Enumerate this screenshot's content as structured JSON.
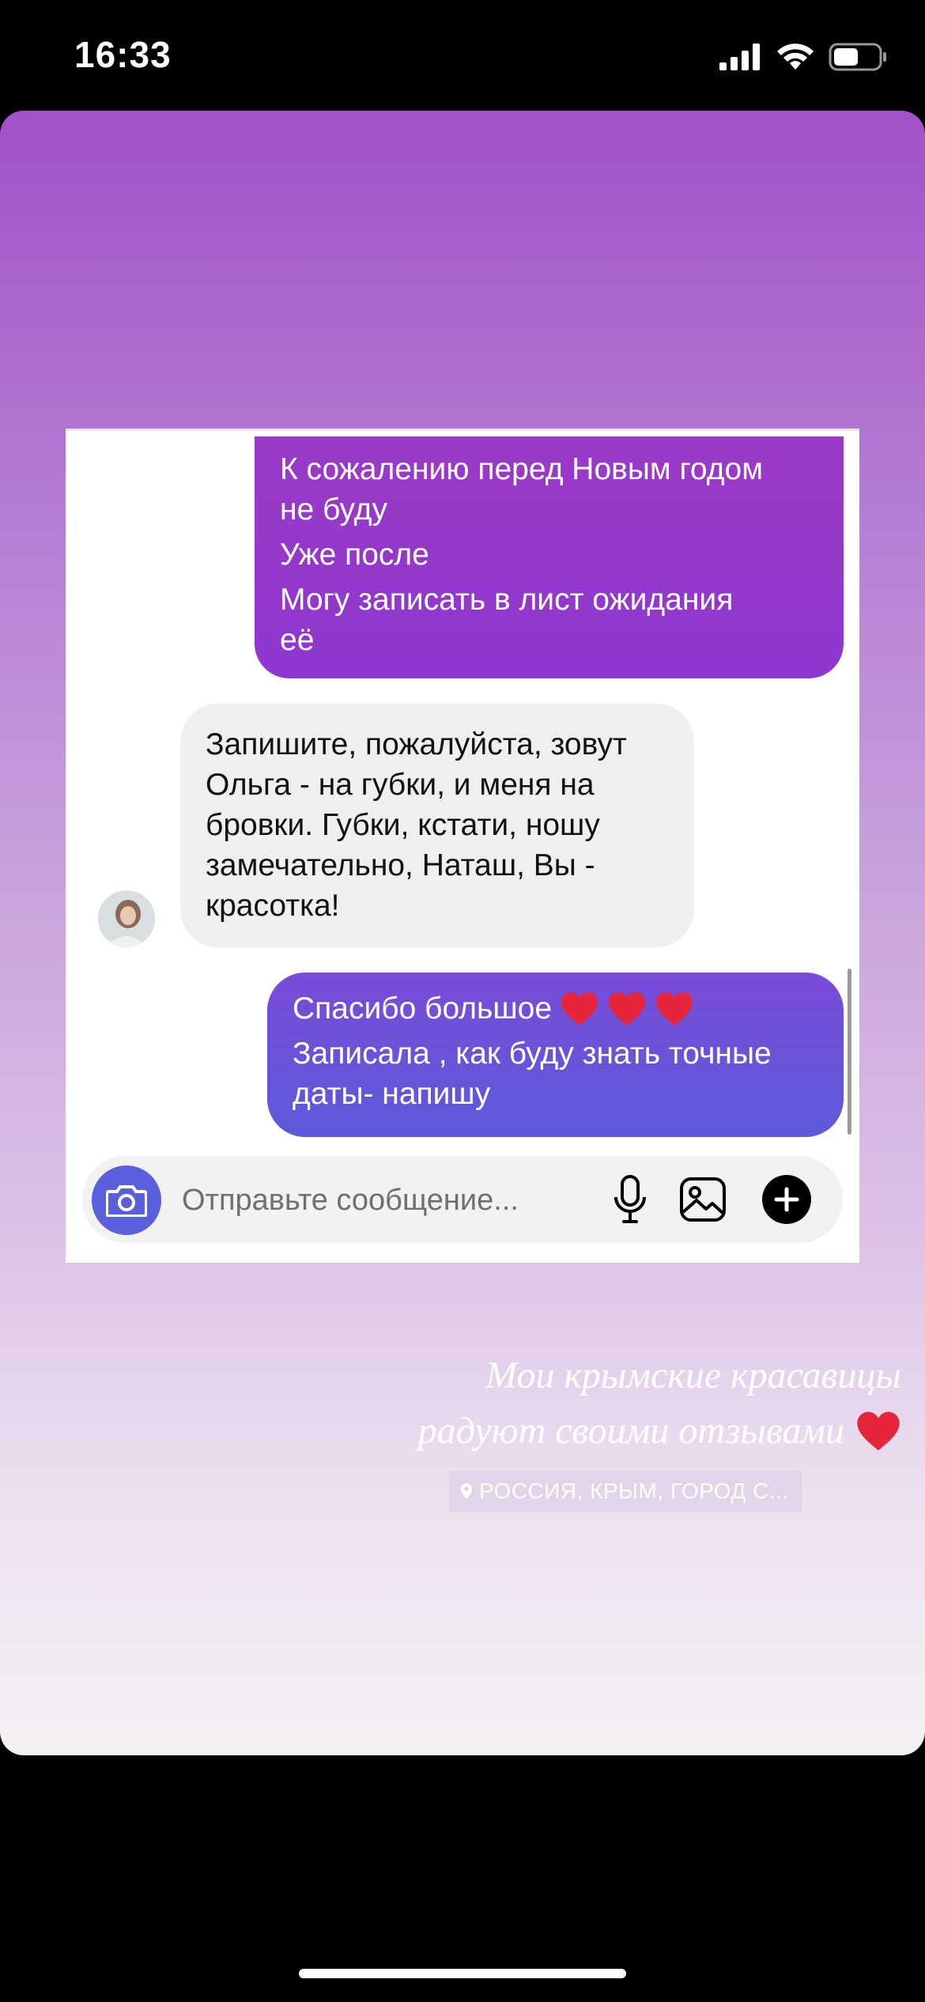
{
  "status_bar": {
    "time": "16:33",
    "icons": [
      "signal-icon",
      "wifi-icon",
      "battery-icon"
    ],
    "battery_level": 0.5
  },
  "story": {
    "background_colors": [
      "#a052c8",
      "#c69fdc",
      "#f4f1f4"
    ],
    "dm_screenshot": {
      "messages": [
        {
          "side": "sent",
          "lines": [
            "К сожалению перед Новым годом",
            "не буду",
            "Уже после",
            "Могу записать в лист ожидания",
            "её"
          ]
        },
        {
          "side": "received",
          "text": "Запишите, пожалуйста, зовут Ольга  - на губки, и меня на бровки. Губки, кстати, ношу замечательно, Наташ, Вы - красотка!"
        },
        {
          "side": "sent",
          "line1": "Спасибо большое",
          "line1_emoji": [
            "heart-icon",
            "heart-icon",
            "heart-icon"
          ],
          "line2": "Записала , как буду знать точные даты- напишу"
        }
      ],
      "composer": {
        "placeholder": "Отправьте сообщение...",
        "icons": [
          "camera-icon",
          "mic-icon",
          "gallery-icon",
          "plus-icon"
        ]
      },
      "colors": {
        "sent_bubble": "#8e37cf",
        "sent_bubble_2": "#6a52d9",
        "received_bubble": "#efefef",
        "camera_button": "#5a5fdb"
      }
    },
    "caption": {
      "line1": "Мои крымские красавицы",
      "line2": "радуют своими отзывами",
      "emoji": "heart-icon"
    },
    "location": {
      "icon": "location-pin-icon",
      "text": "РОССИЯ, КРЫМ, ГОРОД С..."
    }
  }
}
